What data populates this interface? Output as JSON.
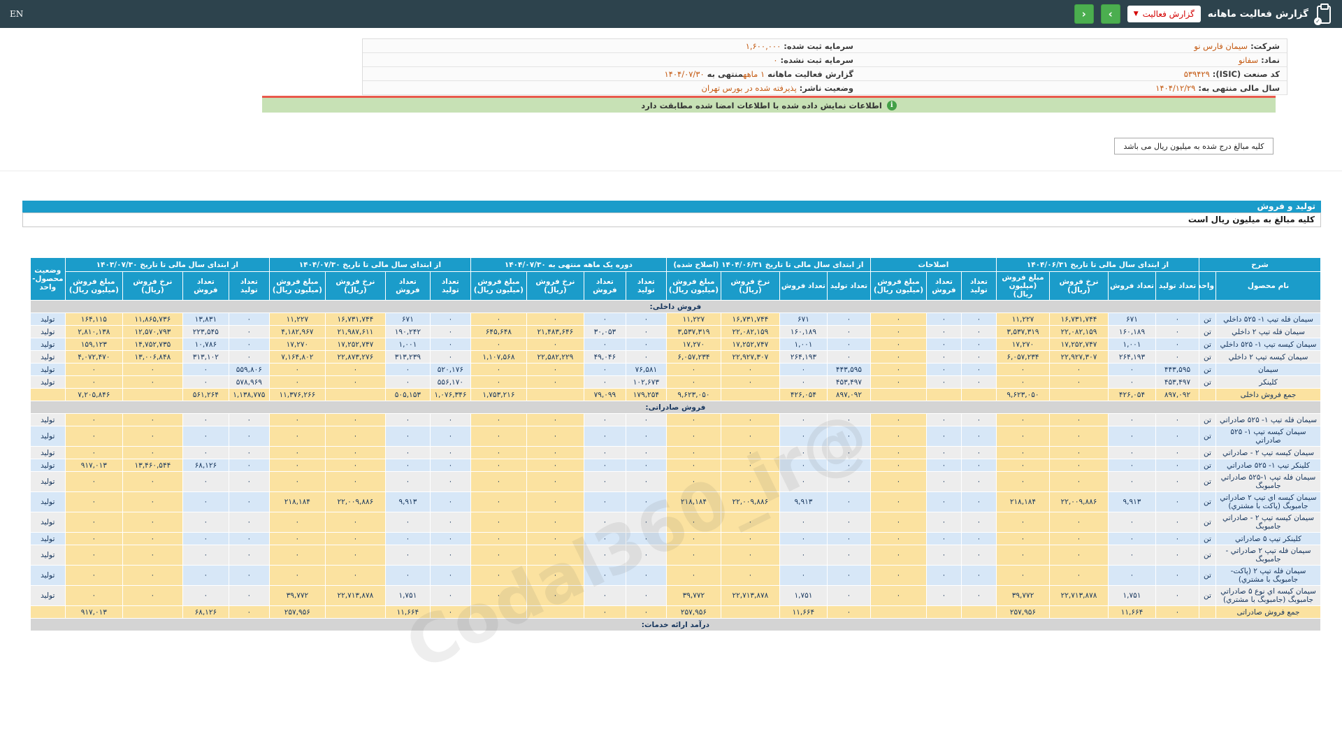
{
  "colors": {
    "navbar_bg": "#2d434d",
    "header_blue": "#1b9cca",
    "cell_yellow": "#fbe2a0",
    "cell_blue": "#d7e7f7",
    "cell_gray": "#ededed",
    "section_gray": "#d4d4d4",
    "value_orange": "#c45911",
    "notice_green_bg": "#c7e1b5",
    "notice_red_border": "#e9594c",
    "button_green": "#4bae4f",
    "dropdown_red": "#d30000",
    "number_navy": "#17365d"
  },
  "navbar": {
    "en_label": "EN",
    "title": "گزارش فعالیت ماهانه",
    "dropdown_label": "گزارش فعالیت",
    "prev_icon": "‹",
    "next_icon": "›",
    "clipboard_check": "✓"
  },
  "info_panel": {
    "rows": [
      {
        "right": [
          {
            "t": "شرکت:  ",
            "o": false
          },
          {
            "t": "سیمان فارس نو",
            "o": true
          }
        ],
        "left": [
          {
            "t": "سرمایه ثبت شده:  ",
            "o": false
          },
          {
            "t": "۱,۶۰۰,۰۰۰",
            "o": true
          }
        ]
      },
      {
        "right": [
          {
            "t": "نماد:  ",
            "o": false
          },
          {
            "t": "سفانو",
            "o": true
          }
        ],
        "left": [
          {
            "t": "سرمایه ثبت نشده:  ",
            "o": false
          },
          {
            "t": "۰",
            "o": true
          }
        ]
      },
      {
        "right": [
          {
            "t": "کد صنعت (ISIC):  ",
            "o": false
          },
          {
            "t": "۵۳۹۴۲۹",
            "o": true
          }
        ],
        "left": [
          {
            "t": "گزارش فعالیت ماهانه ",
            "o": false
          },
          {
            "t": "۱ ماهه",
            "o": true
          },
          {
            "t": "منتهی به ",
            "o": false
          },
          {
            "t": "۱۴۰۴/۰۷/۳۰",
            "o": true
          }
        ]
      },
      {
        "right": [
          {
            "t": "سال مالی منتهی به:  ",
            "o": false
          },
          {
            "t": "۱۴۰۴/۱۲/۲۹",
            "o": true
          }
        ],
        "left": [
          {
            "t": "وضعیت ناشر:  ",
            "o": false
          },
          {
            "t": "پذیرفته شده در بورس تهران",
            "o": true
          }
        ]
      }
    ]
  },
  "notice": {
    "text": "اطلاعات نمایش داده شده با اطلاعات امضا شده مطابقت دارد",
    "icon": "i"
  },
  "unit_note": "کلیه مبالغ درج شده به میلیون ریال می باشد",
  "section": {
    "title": "تولید و فروش",
    "subtitle": "کلیه مبالغ به میلیون ریال است"
  },
  "watermark": "@Codal360_ir",
  "table": {
    "groups": [
      {
        "label": "شرح",
        "cols": [
          "نام محصول",
          "واحد"
        ]
      },
      {
        "label": "از ابتدای سال مالی تا تاریخ ۱۴۰۴/۰۶/۳۱",
        "cols": [
          "تعداد تولید",
          "تعداد فروش",
          "نرخ فروش (ریال)",
          "مبلغ فروش (میلیون ریال)"
        ]
      },
      {
        "label": "اصلاحات",
        "cols": [
          "تعداد تولید",
          "تعداد فروش",
          "مبلغ فروش (میلیون ریال)"
        ]
      },
      {
        "label": "از ابتدای سال مالی تا تاریخ ۱۴۰۴/۰۶/۳۱ (اصلاح شده)",
        "cols": [
          "تعداد تولید",
          "تعداد فروش",
          "نرخ فروش (ریال)",
          "مبلغ فروش (میلیون ریال)"
        ]
      },
      {
        "label": "دوره یک ماهه منتهی به ۱۴۰۴/۰۷/۳۰",
        "cols": [
          "تعداد تولید",
          "تعداد فروش",
          "نرخ فروش (ریال)",
          "مبلغ فروش (میلیون ریال)"
        ]
      },
      {
        "label": "از ابتدای سال مالی تا تاریخ ۱۴۰۴/۰۷/۳۰",
        "cols": [
          "تعداد تولید",
          "تعداد فروش",
          "نرخ فروش (ریال)",
          "مبلغ فروش (میلیون ریال)"
        ]
      },
      {
        "label": "از ابتدای سال مالی تا تاریخ ۱۴۰۳/۰۷/۳۰",
        "cols": [
          "تعداد تولید",
          "تعداد فروش",
          "نرخ فروش (ریال)",
          "مبلغ فروش (میلیون ریال)"
        ]
      },
      {
        "label": "وضعیت محصول-واحد",
        "cols": []
      }
    ],
    "rows": [
      {
        "type": "section",
        "name": "فروش داخلی:"
      },
      {
        "type": "data",
        "name": "سیمان فله تیپ ۱- ۵۲۵ داخلي",
        "unit": "تن",
        "status": "تولید",
        "values": [
          [
            "۰",
            "۶۷۱",
            "۱۶,۷۳۱,۷۴۴",
            "۱۱,۲۲۷"
          ],
          [
            "۰",
            "۰",
            "۰"
          ],
          [
            "۰",
            "۶۷۱",
            "۱۶,۷۳۱,۷۴۴",
            "۱۱,۲۲۷"
          ],
          [
            "۰",
            "۰",
            "۰",
            "۰"
          ],
          [
            "۰",
            "۶۷۱",
            "۱۶,۷۳۱,۷۴۴",
            "۱۱,۲۲۷"
          ],
          [
            "۰",
            "۱۳,۸۳۱",
            "۱۱,۸۶۵,۷۳۶",
            "۱۶۴,۱۱۵"
          ]
        ]
      },
      {
        "type": "data",
        "name": "سیمان فله تیپ ۲ داخلي",
        "unit": "تن",
        "status": "تولید",
        "values": [
          [
            "۰",
            "۱۶۰,۱۸۹",
            "۲۲,۰۸۲,۱۵۹",
            "۳,۵۳۷,۳۱۹"
          ],
          [
            "۰",
            "۰",
            "۰"
          ],
          [
            "۰",
            "۱۶۰,۱۸۹",
            "۲۲,۰۸۲,۱۵۹",
            "۳,۵۳۷,۳۱۹"
          ],
          [
            "۰",
            "۳۰,۰۵۳",
            "۲۱,۴۸۳,۶۴۶",
            "۶۴۵,۶۴۸"
          ],
          [
            "۰",
            "۱۹۰,۲۴۲",
            "۲۱,۹۸۷,۶۱۱",
            "۴,۱۸۲,۹۶۷"
          ],
          [
            "۰",
            "۲۲۳,۵۴۵",
            "۱۲,۵۷۰,۷۹۳",
            "۲,۸۱۰,۱۳۸"
          ]
        ]
      },
      {
        "type": "data",
        "name": "سیمان کیسه تیپ ۱- ۵۲۵ داخلي",
        "unit": "تن",
        "status": "تولید",
        "values": [
          [
            "۰",
            "۱,۰۰۱",
            "۱۷,۲۵۲,۷۴۷",
            "۱۷,۲۷۰"
          ],
          [
            "۰",
            "۰",
            "۰"
          ],
          [
            "۰",
            "۱,۰۰۱",
            "۱۷,۲۵۲,۷۴۷",
            "۱۷,۲۷۰"
          ],
          [
            "۰",
            "۰",
            "۰",
            "۰"
          ],
          [
            "۰",
            "۱,۰۰۱",
            "۱۷,۲۵۲,۷۴۷",
            "۱۷,۲۷۰"
          ],
          [
            "۰",
            "۱۰,۷۸۶",
            "۱۴,۷۵۲,۷۳۵",
            "۱۵۹,۱۲۳"
          ]
        ]
      },
      {
        "type": "data",
        "name": "سیمان کیسه تیپ ۲ داخلي",
        "unit": "تن",
        "status": "تولید",
        "values": [
          [
            "۰",
            "۲۶۴,۱۹۳",
            "۲۲,۹۲۷,۳۰۷",
            "۶,۰۵۷,۲۳۴"
          ],
          [
            "۰",
            "۰",
            "۰"
          ],
          [
            "۰",
            "۲۶۴,۱۹۳",
            "۲۲,۹۲۷,۳۰۷",
            "۶,۰۵۷,۲۳۴"
          ],
          [
            "۰",
            "۴۹,۰۴۶",
            "۲۲,۵۸۲,۲۲۹",
            "۱,۱۰۷,۵۶۸"
          ],
          [
            "۰",
            "۳۱۳,۲۳۹",
            "۲۲,۸۷۳,۲۷۶",
            "۷,۱۶۴,۸۰۲"
          ],
          [
            "۰",
            "۳۱۳,۱۰۲",
            "۱۳,۰۰۶,۸۴۸",
            "۴,۰۷۲,۴۷۰"
          ]
        ]
      },
      {
        "type": "data",
        "name": "سیمان",
        "unit": "تن",
        "status": "تولید",
        "values": [
          [
            "۴۴۳,۵۹۵",
            "۰",
            "۰",
            "۰"
          ],
          [
            "۰",
            "۰",
            "۰"
          ],
          [
            "۴۴۳,۵۹۵",
            "۰",
            "۰",
            "۰"
          ],
          [
            "۷۶,۵۸۱",
            "۰",
            "۰",
            "۰"
          ],
          [
            "۵۲۰,۱۷۶",
            "۰",
            "۰",
            "۰"
          ],
          [
            "۵۵۹,۸۰۶",
            "۰",
            "۰",
            "۰"
          ]
        ]
      },
      {
        "type": "data",
        "name": "کلینکر",
        "unit": "تن",
        "status": "تولید",
        "values": [
          [
            "۴۵۳,۴۹۷",
            "۰",
            "۰",
            "۰"
          ],
          [
            "۰",
            "۰",
            "۰"
          ],
          [
            "۴۵۳,۴۹۷",
            "۰",
            "۰",
            "۰"
          ],
          [
            "۱۰۲,۶۷۳",
            "۰",
            "۰",
            "۰"
          ],
          [
            "۵۵۶,۱۷۰",
            "۰",
            "۰",
            "۰"
          ],
          [
            "۵۷۸,۹۶۹",
            "۰",
            "۰",
            "۰"
          ]
        ]
      },
      {
        "type": "total",
        "name": "جمع فروش داخلی",
        "unit": "",
        "status": "",
        "values": [
          [
            "۸۹۷,۰۹۲",
            "۴۲۶,۰۵۴",
            "",
            "۹,۶۲۳,۰۵۰"
          ],
          [
            "",
            "",
            ""
          ],
          [
            "۸۹۷,۰۹۲",
            "۴۲۶,۰۵۴",
            "",
            "۹,۶۲۳,۰۵۰"
          ],
          [
            "۱۷۹,۲۵۴",
            "۷۹,۰۹۹",
            "",
            "۱,۷۵۳,۲۱۶"
          ],
          [
            "۱,۰۷۶,۳۴۶",
            "۵۰۵,۱۵۳",
            "",
            "۱۱,۳۷۶,۲۶۶"
          ],
          [
            "۱,۱۳۸,۷۷۵",
            "۵۶۱,۲۶۴",
            "",
            "۷,۲۰۵,۸۴۶"
          ]
        ]
      },
      {
        "type": "section",
        "name": "فروش صادراتی:"
      },
      {
        "type": "data",
        "name": "سیمان فله تیپ ۱- ۵۲۵ صادراتي",
        "unit": "تن",
        "status": "تولید",
        "values": [
          [
            "۰",
            "۰",
            "۰",
            "۰"
          ],
          [
            "۰",
            "۰",
            "۰"
          ],
          [
            "۰",
            "۰",
            "۰",
            "۰"
          ],
          [
            "۰",
            "۰",
            "۰",
            "۰"
          ],
          [
            "۰",
            "۰",
            "۰",
            "۰"
          ],
          [
            "۰",
            "۰",
            "۰",
            "۰"
          ]
        ]
      },
      {
        "type": "data",
        "name": "سیمان کیسه تیپ ۱- ۵۲۵ صادراتي",
        "unit": "تن",
        "status": "تولید",
        "values": [
          [
            "۰",
            "۰",
            "۰",
            "۰"
          ],
          [
            "۰",
            "۰",
            "۰"
          ],
          [
            "۰",
            "۰",
            "۰",
            "۰"
          ],
          [
            "۰",
            "۰",
            "۰",
            "۰"
          ],
          [
            "۰",
            "۰",
            "۰",
            "۰"
          ],
          [
            "۰",
            "۰",
            "۰",
            "۰"
          ]
        ]
      },
      {
        "type": "data",
        "name": "سیمان کیسه تیپ ۲ - صادراتي",
        "unit": "تن",
        "status": "تولید",
        "values": [
          [
            "۰",
            "۰",
            "۰",
            "۰"
          ],
          [
            "۰",
            "۰",
            "۰"
          ],
          [
            "۰",
            "۰",
            "۰",
            "۰"
          ],
          [
            "۰",
            "۰",
            "۰",
            "۰"
          ],
          [
            "۰",
            "۰",
            "۰",
            "۰"
          ],
          [
            "۰",
            "۰",
            "۰",
            "۰"
          ]
        ]
      },
      {
        "type": "data",
        "name": "کلینکر تیپ ۱- ۵۲۵ صادراتي",
        "unit": "تن",
        "status": "تولید",
        "values": [
          [
            "۰",
            "۰",
            "۰",
            "۰"
          ],
          [
            "۰",
            "۰",
            "۰"
          ],
          [
            "۰",
            "۰",
            "۰",
            "۰"
          ],
          [
            "۰",
            "۰",
            "۰",
            "۰"
          ],
          [
            "۰",
            "۰",
            "۰",
            "۰"
          ],
          [
            "۰",
            "۶۸,۱۲۶",
            "۱۳,۴۶۰,۵۴۴",
            "۹۱۷,۰۱۳"
          ]
        ]
      },
      {
        "type": "data",
        "name": "سیمان فله تیپ ۱-۵۲۵ صادراتي جامبوبگ",
        "unit": "تن",
        "status": "تولید",
        "values": [
          [
            "۰",
            "۰",
            "۰",
            "۰"
          ],
          [
            "۰",
            "۰",
            "۰"
          ],
          [
            "۰",
            "۰",
            "۰",
            "۰"
          ],
          [
            "۰",
            "۰",
            "۰",
            "۰"
          ],
          [
            "۰",
            "۰",
            "۰",
            "۰"
          ],
          [
            "۰",
            "۰",
            "۰",
            "۰"
          ]
        ]
      },
      {
        "type": "data",
        "name": "سیمان کیسه اي تیپ ۲ صادراتي جامبوبگ (پاکت با مشتري)",
        "unit": "تن",
        "status": "تولید",
        "values": [
          [
            "۰",
            "۹,۹۱۳",
            "۲۲,۰۰۹,۸۸۶",
            "۲۱۸,۱۸۴"
          ],
          [
            "۰",
            "۰",
            "۰"
          ],
          [
            "۰",
            "۹,۹۱۳",
            "۲۲,۰۰۹,۸۸۶",
            "۲۱۸,۱۸۴"
          ],
          [
            "۰",
            "۰",
            "۰",
            "۰"
          ],
          [
            "۰",
            "۹,۹۱۳",
            "۲۲,۰۰۹,۸۸۶",
            "۲۱۸,۱۸۴"
          ],
          [
            "۰",
            "۰",
            "۰",
            "۰"
          ]
        ]
      },
      {
        "type": "data",
        "name": "سیمان کیسه تیپ ۲ - صادراتي جامبوبگ",
        "unit": "تن",
        "status": "تولید",
        "values": [
          [
            "۰",
            "۰",
            "۰",
            "۰"
          ],
          [
            "۰",
            "۰",
            "۰"
          ],
          [
            "۰",
            "۰",
            "۰",
            "۰"
          ],
          [
            "۰",
            "۰",
            "۰",
            "۰"
          ],
          [
            "۰",
            "۰",
            "۰",
            "۰"
          ],
          [
            "۰",
            "۰",
            "۰",
            "۰"
          ]
        ]
      },
      {
        "type": "data",
        "name": "کلینکر تیپ ۵ صادراتي",
        "unit": "تن",
        "status": "تولید",
        "values": [
          [
            "۰",
            "۰",
            "۰",
            "۰"
          ],
          [
            "۰",
            "۰",
            "۰"
          ],
          [
            "۰",
            "۰",
            "۰",
            "۰"
          ],
          [
            "۰",
            "۰",
            "۰",
            "۰"
          ],
          [
            "۰",
            "۰",
            "۰",
            "۰"
          ],
          [
            "۰",
            "۰",
            "۰",
            "۰"
          ]
        ]
      },
      {
        "type": "data",
        "name": "سیمان فله تیپ ۲ صادراتي - جامبوبگ",
        "unit": "تن",
        "status": "تولید",
        "values": [
          [
            "۰",
            "۰",
            "۰",
            "۰"
          ],
          [
            "۰",
            "۰",
            "۰"
          ],
          [
            "۰",
            "۰",
            "۰",
            "۰"
          ],
          [
            "۰",
            "۰",
            "۰",
            "۰"
          ],
          [
            "۰",
            "۰",
            "۰",
            "۰"
          ],
          [
            "۰",
            "۰",
            "۰",
            "۰"
          ]
        ]
      },
      {
        "type": "data",
        "name": "سیمان فله تیپ ۲ (پاکت- جامبوبگ با مشتري)",
        "unit": "تن",
        "status": "تولید",
        "values": [
          [
            "۰",
            "۰",
            "۰",
            "۰"
          ],
          [
            "۰",
            "۰",
            "۰"
          ],
          [
            "۰",
            "۰",
            "۰",
            "۰"
          ],
          [
            "۰",
            "۰",
            "۰",
            "۰"
          ],
          [
            "۰",
            "۰",
            "۰",
            "۰"
          ],
          [
            "۰",
            "۰",
            "۰",
            "۰"
          ]
        ]
      },
      {
        "type": "data",
        "name": "سیمان کیسه اي نوع ۵ صادراتي جامبوبگ (جامبوبگ با مشتري)",
        "unit": "تن",
        "status": "تولید",
        "values": [
          [
            "۰",
            "۱,۷۵۱",
            "۲۲,۷۱۳,۸۷۸",
            "۳۹,۷۷۲"
          ],
          [
            "۰",
            "۰",
            "۰"
          ],
          [
            "۰",
            "۱,۷۵۱",
            "۲۲,۷۱۳,۸۷۸",
            "۳۹,۷۷۲"
          ],
          [
            "۰",
            "۰",
            "۰",
            "۰"
          ],
          [
            "۰",
            "۱,۷۵۱",
            "۲۲,۷۱۳,۸۷۸",
            "۳۹,۷۷۲"
          ],
          [
            "۰",
            "۰",
            "۰",
            "۰"
          ]
        ]
      },
      {
        "type": "total",
        "name": "جمع فروش صادراتی",
        "unit": "",
        "status": "",
        "values": [
          [
            "۰",
            "۱۱,۶۶۴",
            "",
            "۲۵۷,۹۵۶"
          ],
          [
            "",
            "",
            ""
          ],
          [
            "۰",
            "۱۱,۶۶۴",
            "",
            "۲۵۷,۹۵۶"
          ],
          [
            "۰",
            "۰",
            "",
            ""
          ],
          [
            "۰",
            "۱۱,۶۶۴",
            "",
            "۲۵۷,۹۵۶"
          ],
          [
            "۰",
            "۶۸,۱۲۶",
            "",
            "۹۱۷,۰۱۳"
          ]
        ]
      },
      {
        "type": "section",
        "name": "درآمد ارائه خدمات:"
      }
    ]
  }
}
